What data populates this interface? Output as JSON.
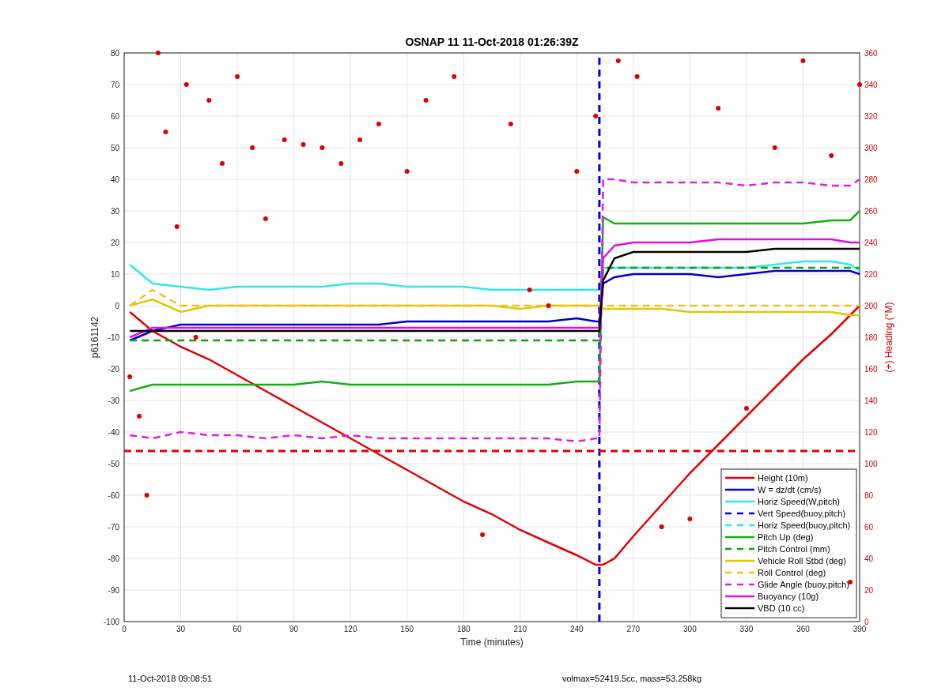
{
  "figure": {
    "chart_data": {
      "type": "line",
      "title": "OSNAP 11 11-Oct-2018 01:26:39Z",
      "xlabel": "Time (minutes)",
      "ylabel": "p6161142",
      "x": [
        3,
        15,
        30,
        45,
        60,
        75,
        90,
        105,
        120,
        135,
        150,
        165,
        180,
        195,
        210,
        225,
        240,
        250,
        252,
        252,
        254,
        260,
        270,
        285,
        300,
        315,
        330,
        345,
        360,
        375,
        385,
        390
      ],
      "xlim": [
        0,
        390
      ],
      "ylim": [
        -100,
        80
      ],
      "xticks": [
        0,
        30,
        60,
        90,
        120,
        150,
        180,
        210,
        240,
        270,
        300,
        330,
        360,
        390
      ],
      "yticks": [
        -100,
        -90,
        -80,
        -70,
        -60,
        -50,
        -40,
        -30,
        -20,
        -10,
        0,
        10,
        20,
        30,
        40,
        50,
        60,
        70,
        80
      ],
      "series": [
        {
          "name": "Height (10m)",
          "color": "#e00000",
          "line_style": "solid",
          "values": [
            -2,
            -8,
            -13,
            -17,
            -22,
            -27,
            -32,
            -37,
            -42,
            -47,
            -52,
            -57,
            -62,
            -66,
            -71,
            -75,
            -79,
            -82,
            -82,
            -82,
            -82,
            -80,
            -73,
            -63,
            -53,
            -44,
            -35,
            -26,
            -17,
            -9,
            -3,
            0
          ]
        },
        {
          "name": "W = dz/dt (cm/s)",
          "color": "#0000c8",
          "line_style": "solid",
          "values": [
            -11,
            -8,
            -6,
            -6,
            -6,
            -6,
            -6,
            -6,
            -6,
            -6,
            -5,
            -5,
            -5,
            -5,
            -5,
            -5,
            -4,
            -5,
            -5,
            -5,
            7,
            9,
            10,
            10,
            10,
            9,
            10,
            11,
            11,
            11,
            11,
            10
          ]
        },
        {
          "name": "Horiz Speed(W,pitch)",
          "color": "#30e8f0",
          "line_style": "solid",
          "values": [
            13,
            7,
            6,
            5,
            6,
            6,
            6,
            6,
            7,
            7,
            6,
            6,
            6,
            5,
            5,
            5,
            5,
            5,
            5,
            5,
            12,
            12,
            12,
            12,
            12,
            12,
            12,
            13,
            14,
            14,
            13,
            11
          ]
        },
        {
          "name": "Vert Speed(buoy,pitch)",
          "color": "#0000e0",
          "line_style": "dashed",
          "values": [
            null,
            null,
            null,
            null,
            null,
            null,
            null,
            null,
            null,
            null,
            null,
            null,
            null,
            null,
            null,
            null,
            null,
            null,
            -100,
            80,
            null,
            null,
            null,
            null,
            null,
            null,
            null,
            null,
            null,
            null,
            null,
            null
          ]
        },
        {
          "name": "Horiz Speed(buoy,pitch)",
          "color": "#30e8f0",
          "line_style": "dashed",
          "values": [
            null,
            null,
            null,
            null,
            null,
            null,
            null,
            null,
            null,
            null,
            null,
            null,
            null,
            null,
            null,
            null,
            null,
            null,
            null,
            null,
            null,
            null,
            null,
            null,
            null,
            null,
            null,
            null,
            null,
            null,
            null,
            null
          ]
        },
        {
          "name": "Pitch Up (deg)",
          "color": "#10b010",
          "line_style": "solid",
          "values": [
            -27,
            -25,
            -25,
            -25,
            -25,
            -25,
            -25,
            -24,
            -25,
            -25,
            -25,
            -25,
            -25,
            -25,
            -25,
            -25,
            -24,
            -24,
            -24,
            -24,
            28,
            26,
            26,
            26,
            26,
            26,
            26,
            26,
            26,
            27,
            27,
            30
          ]
        },
        {
          "name": "Pitch Control (mm)",
          "color": "#10a010",
          "line_style": "dashed",
          "values": [
            -11,
            -11,
            -11,
            -11,
            -11,
            -11,
            -11,
            -11,
            -11,
            -11,
            -11,
            -11,
            -11,
            -11,
            -11,
            -11,
            -11,
            -11,
            -11,
            -11,
            12,
            12,
            12,
            12,
            12,
            12,
            12,
            12,
            12,
            12,
            12,
            12
          ]
        },
        {
          "name": "Vehicle Roll Stbd (deg)",
          "color": "#e0c800",
          "line_style": "solid",
          "values": [
            0,
            2,
            -2,
            0,
            0,
            0,
            0,
            0,
            0,
            0,
            0,
            0,
            0,
            0,
            -1,
            0,
            0,
            0,
            0,
            0,
            -1,
            -1,
            -1,
            -1,
            -2,
            -2,
            -2,
            -2,
            -2,
            -2,
            -3,
            -3
          ]
        },
        {
          "name": "Roll Control (deg)",
          "color": "#f0c020",
          "line_style": "dashed",
          "values": [
            0,
            5,
            0,
            0,
            0,
            0,
            0,
            0,
            0,
            0,
            0,
            0,
            0,
            0,
            0,
            0,
            0,
            0,
            0,
            0,
            0,
            0,
            0,
            0,
            0,
            0,
            0,
            0,
            0,
            0,
            0,
            0
          ]
        },
        {
          "name": "Glide Angle (buoy,pitch)",
          "color": "#e020e0",
          "line_style": "dashed",
          "values": [
            -41,
            -42,
            -40,
            -41,
            -41,
            -42,
            -41,
            -42,
            -41,
            -42,
            -42,
            -42,
            -42,
            -42,
            -42,
            -42,
            -43,
            -42,
            -42,
            -42,
            40,
            40,
            39,
            39,
            39,
            39,
            38,
            39,
            39,
            38,
            38,
            40
          ]
        },
        {
          "name": "Buoyancy (10g)",
          "color": "#e010e0",
          "line_style": "solid",
          "values": [
            -10,
            -7,
            -7,
            -7,
            -7,
            -7,
            -7,
            -7,
            -7,
            -7,
            -7,
            -7,
            -7,
            -7,
            -7,
            -7,
            -7,
            -7,
            -7,
            -7,
            15,
            19,
            20,
            20,
            20,
            21,
            21,
            21,
            21,
            21,
            20,
            20
          ]
        },
        {
          "name": "VBD (10 cc)",
          "color": "#000000",
          "line_style": "solid",
          "values": [
            -8,
            -8,
            -8,
            -8,
            -8,
            -8,
            -8,
            -8,
            -8,
            -8,
            -8,
            -8,
            -8,
            -8,
            -8,
            -8,
            -8,
            -8,
            -8,
            -8,
            8,
            15,
            17,
            17,
            17,
            17,
            17,
            18,
            18,
            18,
            18,
            18
          ]
        }
      ],
      "grid": true,
      "ref_lines": [
        {
          "axis": "y",
          "value": -46
        }
      ]
    },
    "heading_overlay": {
      "chart_data": {
        "type": "scatter",
        "ylabel": "(+) Heading (°M)",
        "xlim": [
          0,
          390
        ],
        "ylim": [
          0,
          360
        ],
        "yticks": [
          0,
          20,
          40,
          60,
          80,
          100,
          120,
          140,
          160,
          180,
          200,
          220,
          240,
          260,
          280,
          300,
          320,
          340,
          360
        ],
        "x": [
          3,
          8,
          12,
          18,
          22,
          28,
          33,
          38,
          45,
          52,
          60,
          68,
          75,
          85,
          95,
          105,
          115,
          125,
          135,
          150,
          160,
          175,
          190,
          205,
          215,
          225,
          240,
          250,
          262,
          272,
          285,
          300,
          315,
          330,
          345,
          360,
          375,
          385,
          390
        ],
        "series": [
          {
            "color": "#dd0000",
            "values": [
              155,
              130,
              80,
              360,
              310,
              250,
              340,
              180,
              330,
              290,
              345,
              300,
              255,
              305,
              302,
              300,
              290,
              305,
              315,
              285,
              330,
              345,
              55,
              315,
              210,
              200,
              285,
              320,
              355,
              345,
              60,
              65,
              325,
              135,
              300,
              355,
              295,
              25,
              340
            ]
          }
        ]
      }
    }
  },
  "footer": {
    "timestamp": "11-Oct-2018 09:08:51",
    "info": "volmax=52419.5cc, mass=53.258kg"
  }
}
